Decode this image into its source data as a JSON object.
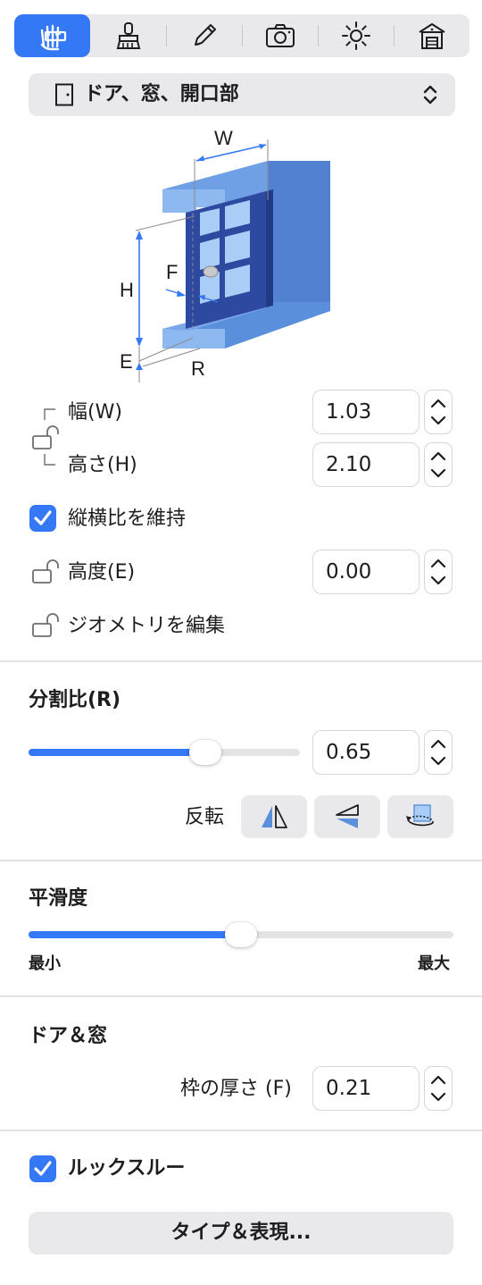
{
  "toolbar": {
    "tabs": [
      {
        "icon": "measure-hand-icon",
        "active": true
      },
      {
        "icon": "paint-brush-icon",
        "active": false
      },
      {
        "icon": "pencil-icon",
        "active": false
      },
      {
        "icon": "camera-icon",
        "active": false
      },
      {
        "icon": "sun-icon",
        "active": false
      },
      {
        "icon": "house-icon",
        "active": false
      }
    ]
  },
  "object_type": {
    "label": "ドア、窓、開口部",
    "icon": "door-icon"
  },
  "diagram": {
    "labels": {
      "w": "W",
      "h": "H",
      "f": "F",
      "e": "E",
      "r": "R"
    }
  },
  "dimensions": {
    "width_label": "幅(W)",
    "width_value": "1.03",
    "height_label": "高さ(H)",
    "height_value": "2.10",
    "keep_ratio_label": "縦横比を維持",
    "keep_ratio_checked": true,
    "elevation_label": "高度(E)",
    "elevation_value": "0.00",
    "edit_geometry_label": "ジオメトリを編集"
  },
  "split_ratio": {
    "title": "分割比(R)",
    "value": "0.65",
    "slider_fraction": 0.65,
    "flip_label": "反転"
  },
  "smoothness": {
    "title": "平滑度",
    "slider_fraction": 0.5,
    "min_label": "最小",
    "max_label": "最大"
  },
  "door_window": {
    "title": "ドア＆窓",
    "frame_thickness_label": "枠の厚さ (F)",
    "frame_thickness_value": "0.21"
  },
  "look_through": {
    "label": "ルックスルー",
    "checked": true
  },
  "type_button": {
    "label": "タイプ＆表現..."
  },
  "colors": {
    "accent": "#3478f6",
    "control_bg": "#e9e9eb",
    "wall_blue": "#5b8fd9",
    "glass": "#a9cdf6",
    "frame": "#2e4aa0"
  }
}
